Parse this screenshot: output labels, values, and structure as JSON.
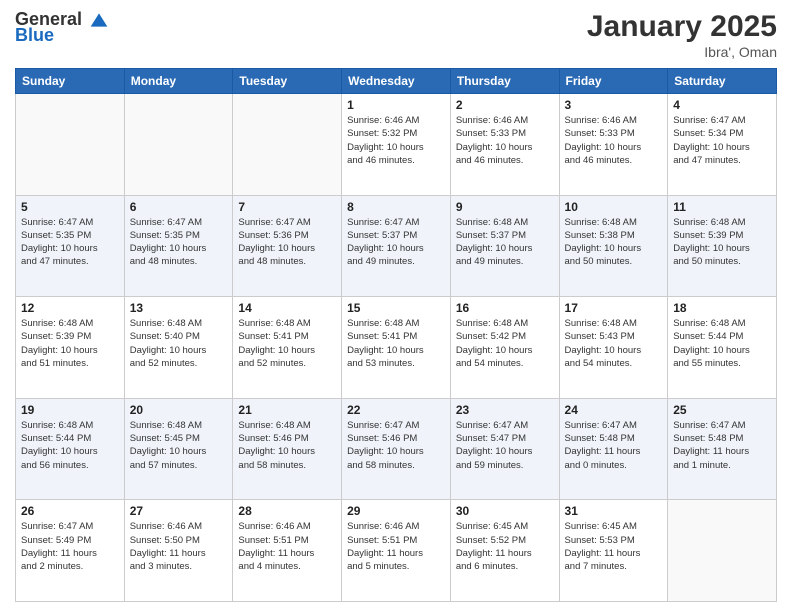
{
  "header": {
    "logo_general": "General",
    "logo_blue": "Blue",
    "month_title": "January 2025",
    "location": "Ibra', Oman"
  },
  "weekdays": [
    "Sunday",
    "Monday",
    "Tuesday",
    "Wednesday",
    "Thursday",
    "Friday",
    "Saturday"
  ],
  "weeks": [
    [
      {
        "day": "",
        "info": ""
      },
      {
        "day": "",
        "info": ""
      },
      {
        "day": "",
        "info": ""
      },
      {
        "day": "1",
        "info": "Sunrise: 6:46 AM\nSunset: 5:32 PM\nDaylight: 10 hours\nand 46 minutes."
      },
      {
        "day": "2",
        "info": "Sunrise: 6:46 AM\nSunset: 5:33 PM\nDaylight: 10 hours\nand 46 minutes."
      },
      {
        "day": "3",
        "info": "Sunrise: 6:46 AM\nSunset: 5:33 PM\nDaylight: 10 hours\nand 46 minutes."
      },
      {
        "day": "4",
        "info": "Sunrise: 6:47 AM\nSunset: 5:34 PM\nDaylight: 10 hours\nand 47 minutes."
      }
    ],
    [
      {
        "day": "5",
        "info": "Sunrise: 6:47 AM\nSunset: 5:35 PM\nDaylight: 10 hours\nand 47 minutes."
      },
      {
        "day": "6",
        "info": "Sunrise: 6:47 AM\nSunset: 5:35 PM\nDaylight: 10 hours\nand 48 minutes."
      },
      {
        "day": "7",
        "info": "Sunrise: 6:47 AM\nSunset: 5:36 PM\nDaylight: 10 hours\nand 48 minutes."
      },
      {
        "day": "8",
        "info": "Sunrise: 6:47 AM\nSunset: 5:37 PM\nDaylight: 10 hours\nand 49 minutes."
      },
      {
        "day": "9",
        "info": "Sunrise: 6:48 AM\nSunset: 5:37 PM\nDaylight: 10 hours\nand 49 minutes."
      },
      {
        "day": "10",
        "info": "Sunrise: 6:48 AM\nSunset: 5:38 PM\nDaylight: 10 hours\nand 50 minutes."
      },
      {
        "day": "11",
        "info": "Sunrise: 6:48 AM\nSunset: 5:39 PM\nDaylight: 10 hours\nand 50 minutes."
      }
    ],
    [
      {
        "day": "12",
        "info": "Sunrise: 6:48 AM\nSunset: 5:39 PM\nDaylight: 10 hours\nand 51 minutes."
      },
      {
        "day": "13",
        "info": "Sunrise: 6:48 AM\nSunset: 5:40 PM\nDaylight: 10 hours\nand 52 minutes."
      },
      {
        "day": "14",
        "info": "Sunrise: 6:48 AM\nSunset: 5:41 PM\nDaylight: 10 hours\nand 52 minutes."
      },
      {
        "day": "15",
        "info": "Sunrise: 6:48 AM\nSunset: 5:41 PM\nDaylight: 10 hours\nand 53 minutes."
      },
      {
        "day": "16",
        "info": "Sunrise: 6:48 AM\nSunset: 5:42 PM\nDaylight: 10 hours\nand 54 minutes."
      },
      {
        "day": "17",
        "info": "Sunrise: 6:48 AM\nSunset: 5:43 PM\nDaylight: 10 hours\nand 54 minutes."
      },
      {
        "day": "18",
        "info": "Sunrise: 6:48 AM\nSunset: 5:44 PM\nDaylight: 10 hours\nand 55 minutes."
      }
    ],
    [
      {
        "day": "19",
        "info": "Sunrise: 6:48 AM\nSunset: 5:44 PM\nDaylight: 10 hours\nand 56 minutes."
      },
      {
        "day": "20",
        "info": "Sunrise: 6:48 AM\nSunset: 5:45 PM\nDaylight: 10 hours\nand 57 minutes."
      },
      {
        "day": "21",
        "info": "Sunrise: 6:48 AM\nSunset: 5:46 PM\nDaylight: 10 hours\nand 58 minutes."
      },
      {
        "day": "22",
        "info": "Sunrise: 6:47 AM\nSunset: 5:46 PM\nDaylight: 10 hours\nand 58 minutes."
      },
      {
        "day": "23",
        "info": "Sunrise: 6:47 AM\nSunset: 5:47 PM\nDaylight: 10 hours\nand 59 minutes."
      },
      {
        "day": "24",
        "info": "Sunrise: 6:47 AM\nSunset: 5:48 PM\nDaylight: 11 hours\nand 0 minutes."
      },
      {
        "day": "25",
        "info": "Sunrise: 6:47 AM\nSunset: 5:48 PM\nDaylight: 11 hours\nand 1 minute."
      }
    ],
    [
      {
        "day": "26",
        "info": "Sunrise: 6:47 AM\nSunset: 5:49 PM\nDaylight: 11 hours\nand 2 minutes."
      },
      {
        "day": "27",
        "info": "Sunrise: 6:46 AM\nSunset: 5:50 PM\nDaylight: 11 hours\nand 3 minutes."
      },
      {
        "day": "28",
        "info": "Sunrise: 6:46 AM\nSunset: 5:51 PM\nDaylight: 11 hours\nand 4 minutes."
      },
      {
        "day": "29",
        "info": "Sunrise: 6:46 AM\nSunset: 5:51 PM\nDaylight: 11 hours\nand 5 minutes."
      },
      {
        "day": "30",
        "info": "Sunrise: 6:45 AM\nSunset: 5:52 PM\nDaylight: 11 hours\nand 6 minutes."
      },
      {
        "day": "31",
        "info": "Sunrise: 6:45 AM\nSunset: 5:53 PM\nDaylight: 11 hours\nand 7 minutes."
      },
      {
        "day": "",
        "info": ""
      }
    ]
  ]
}
